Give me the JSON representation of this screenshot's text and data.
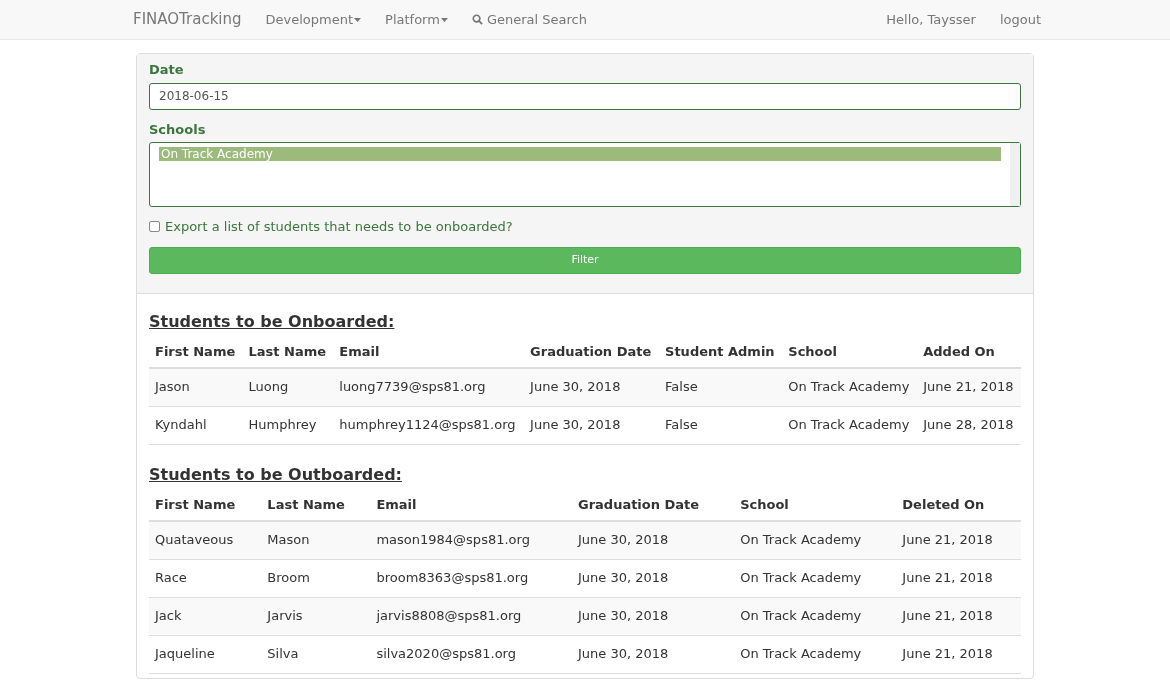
{
  "navbar": {
    "brand": "FINAOTracking",
    "menus": [
      {
        "label": "Development",
        "kind": "dropdown"
      },
      {
        "label": "Platform",
        "kind": "dropdown"
      },
      {
        "label": "General Search",
        "kind": "search"
      }
    ],
    "greeting": "Hello, Taysser",
    "logout": "logout"
  },
  "filter": {
    "date_label": "Date",
    "date_value": "2018-06-15",
    "schools_label": "Schools",
    "schools": [
      {
        "label": "On Track Academy",
        "selected": true
      }
    ],
    "export_label": "Export a list of students that needs to be onboarded?",
    "export_checked": false,
    "button": "Filter"
  },
  "onboarded": {
    "title": "Students to be Onboarded:",
    "columns": [
      "First Name",
      "Last Name",
      "Email",
      "Graduation Date",
      "Student Admin",
      "School",
      "Added On"
    ],
    "rows": [
      [
        "Jason",
        "Luong",
        "luong7739@sps81.org",
        "June 30, 2018",
        "False",
        "On Track Academy",
        "June 21, 2018"
      ],
      [
        "Kyndahl",
        "Humphrey",
        "humphrey1124@sps81.org",
        "June 30, 2018",
        "False",
        "On Track Academy",
        "June 28, 2018"
      ]
    ]
  },
  "outboarded": {
    "title": "Students to be Outboarded:",
    "columns": [
      "First Name",
      "Last Name",
      "Email",
      "Graduation Date",
      "School",
      "Deleted On"
    ],
    "rows": [
      [
        "Quataveous",
        "Mason",
        "mason1984@sps81.org",
        "June 30, 2018",
        "On Track Academy",
        "June 21, 2018"
      ],
      [
        "Race",
        "Broom",
        "broom8363@sps81.org",
        "June 30, 2018",
        "On Track Academy",
        "June 21, 2018"
      ],
      [
        "Jack",
        "Jarvis",
        "jarvis8808@sps81.org",
        "June 30, 2018",
        "On Track Academy",
        "June 21, 2018"
      ],
      [
        "Jaqueline",
        "Silva",
        "silva2020@sps81.org",
        "June 30, 2018",
        "On Track Academy",
        "June 21, 2018"
      ]
    ]
  }
}
